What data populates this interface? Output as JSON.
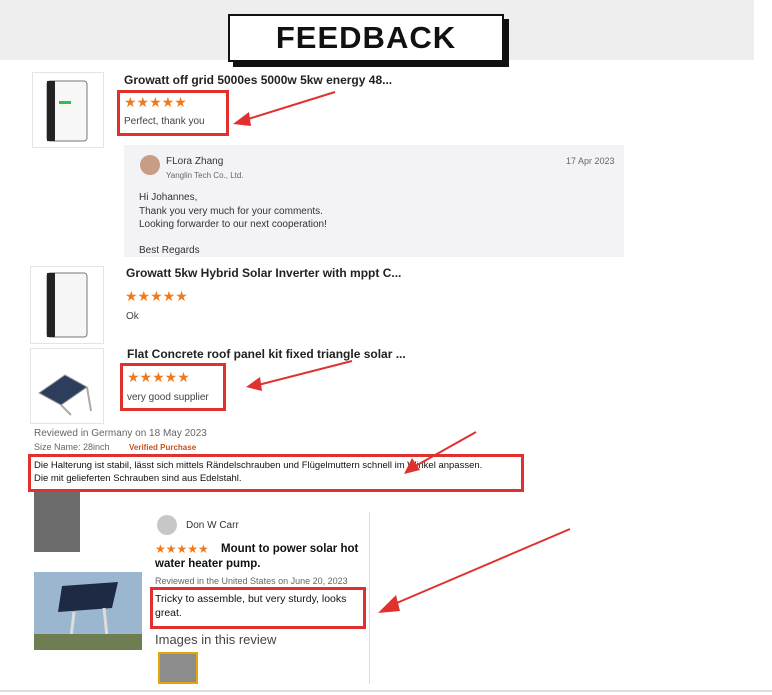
{
  "header": {
    "title": "FEEDBACK"
  },
  "reviews": [
    {
      "product": "Growatt off grid 5000es 5000w 5kw energy 48...",
      "stars": "★★★★★",
      "comment": "Perfect, thank you"
    },
    {
      "product": "Growatt 5kw Hybrid Solar Inverter with mppt C...",
      "stars": "★★★★★",
      "comment": "Ok"
    },
    {
      "product": "Flat Concrete roof panel kit fixed triangle solar ...",
      "stars": "★★★★★",
      "comment": "very good supplier"
    }
  ],
  "seller_reply": {
    "name": "FLora Zhang",
    "company": "Yanglin Tech Co., Ltd.",
    "date": "17 Apr 2023",
    "line1": "Hi Johannes,",
    "line2": "Thank you very much for your comments.",
    "line3": "Looking forwarder to our next cooperation!",
    "line4": "Best Regards"
  },
  "german_review": {
    "meta1": "Reviewed in Germany on 18 May 2023",
    "meta2_label": "Size Name: 28inch",
    "verified": "Verified Purchase",
    "text1": "Die Halterung ist stabil, lässt sich mittels Rändelschrauben und Flügelmuttern schnell im Winkel anpassen.",
    "text2": "Die mit gelieferten Schrauben sind aus Edelstahl."
  },
  "us_review": {
    "reviewer": "Don W Carr",
    "stars": "★★★★★",
    "headline1": "Mount to power solar hot",
    "headline2": "water heater pump.",
    "meta": "Reviewed in the United States on June 20, 2023",
    "text1": "Tricky to assemble, but very sturdy, looks",
    "text2": "great.",
    "images_label": "Images in this review"
  },
  "colors": {
    "accent_red": "#e0312f",
    "star_orange": "#f07a1b",
    "verified_orange": "#c7511f"
  },
  "icons": [
    "inverter-product-image",
    "inverter-product-image",
    "solar-panel-mount-image",
    "user-avatar-icon",
    "star-icon",
    "arrow-icon"
  ]
}
